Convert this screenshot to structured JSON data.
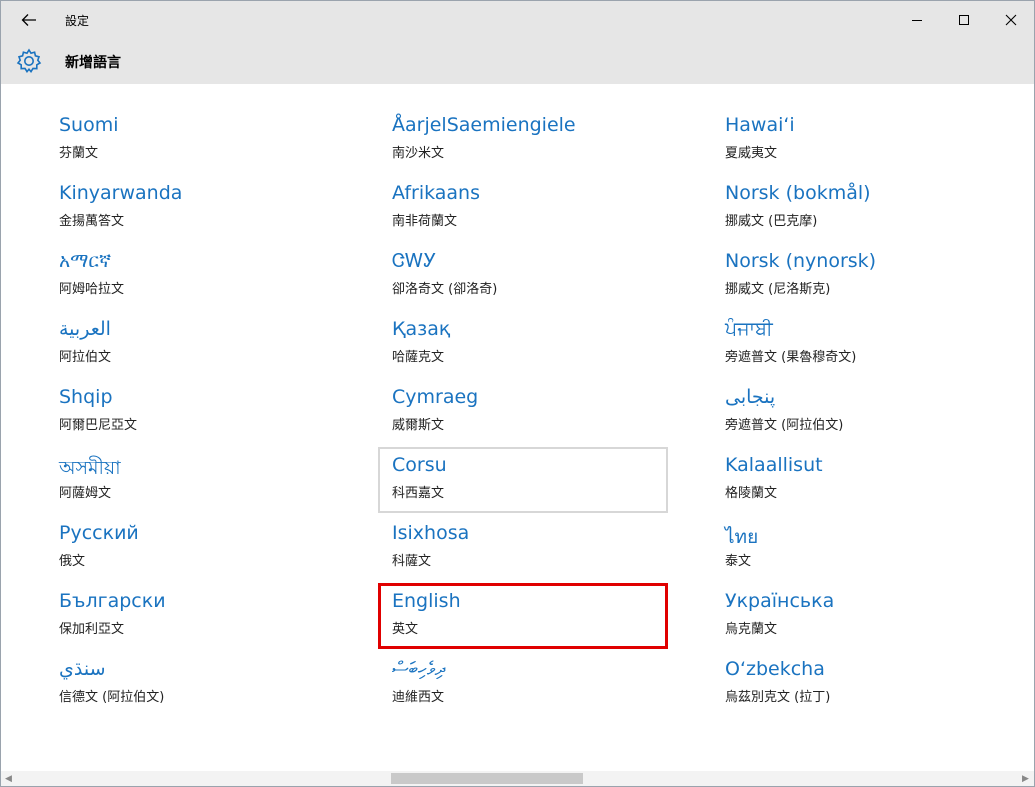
{
  "window": {
    "title": "設定"
  },
  "page": {
    "title": "新增語言"
  },
  "icons": {
    "back": "back-arrow-icon",
    "settings": "gear-icon",
    "minimize": "minimize-icon",
    "maximize": "maximize-icon",
    "close": "close-icon"
  },
  "colors": {
    "accent": "#1a73c0",
    "selection": "#e00000",
    "header_bg": "#e6e6e6"
  },
  "columns": [
    [
      {
        "name": "Suomi",
        "sub": "芬蘭文"
      },
      {
        "name": "Kinyarwanda",
        "sub": "金揚萬答文"
      },
      {
        "name": "አማርኛ",
        "sub": "阿姆哈拉文"
      },
      {
        "name": "العربية",
        "sub": "阿拉伯文"
      },
      {
        "name": "Shqip",
        "sub": "阿爾巴尼亞文"
      },
      {
        "name": "অসমীয়া",
        "sub": "阿薩姆文"
      },
      {
        "name": "Русский",
        "sub": "俄文"
      },
      {
        "name": "Български",
        "sub": "保加利亞文"
      },
      {
        "name": "سنڌي",
        "sub": "信德文 (阿拉伯文)"
      }
    ],
    [
      {
        "name": "ÅarjelSaemiengiele",
        "sub": "南沙米文"
      },
      {
        "name": "Afrikaans",
        "sub": "南非荷蘭文"
      },
      {
        "name": "ᏣᎳᎩ",
        "sub": "卻洛奇文 (卻洛奇)"
      },
      {
        "name": "Қазақ",
        "sub": "哈薩克文"
      },
      {
        "name": "Cymraeg",
        "sub": "威爾斯文"
      },
      {
        "name": "Corsu",
        "sub": "科西嘉文"
      },
      {
        "name": "Isixhosa",
        "sub": "科薩文"
      },
      {
        "name": "English",
        "sub": "英文"
      },
      {
        "name": "ދިވެހިބަސް",
        "sub": "迪維西文"
      }
    ],
    [
      {
        "name": "Hawaiʻi",
        "sub": "夏威夷文"
      },
      {
        "name": "Norsk (bokmål)",
        "sub": "挪威文 (巴克摩)"
      },
      {
        "name": "Norsk (nynorsk)",
        "sub": "挪威文 (尼洛斯克)"
      },
      {
        "name": "ਪੰਜਾਬੀ",
        "sub": "旁遮普文 (果魯穆奇文)"
      },
      {
        "name": "پنجابی",
        "sub": "旁遮普文 (阿拉伯文)"
      },
      {
        "name": "Kalaallisut",
        "sub": "格陵蘭文"
      },
      {
        "name": "ไทย",
        "sub": "泰文"
      },
      {
        "name": "Українська",
        "sub": "烏克蘭文"
      },
      {
        "name": "Oʻzbekcha",
        "sub": "烏茲別克文 (拉丁)"
      }
    ]
  ],
  "hovered_item": "Corsu",
  "selected_item": "English"
}
